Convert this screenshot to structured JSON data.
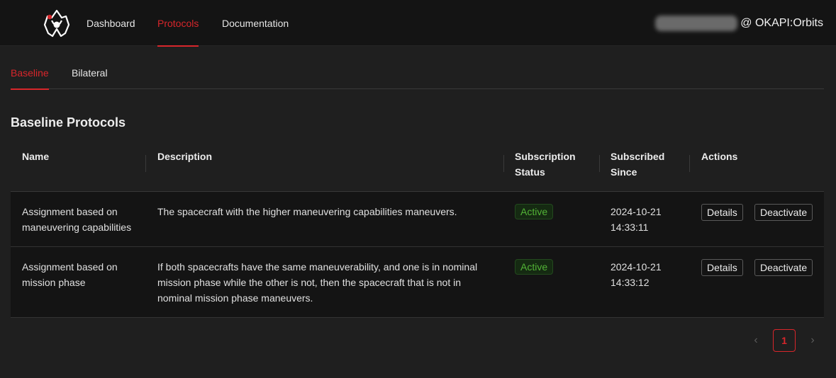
{
  "nav": {
    "items": [
      {
        "label": "Dashboard"
      },
      {
        "label": "Protocols",
        "active": true
      },
      {
        "label": "Documentation"
      }
    ],
    "user_suffix": "@ OKAPI:Orbits",
    "accent_color": "#d8262b"
  },
  "subtabs": [
    {
      "label": "Baseline",
      "active": true
    },
    {
      "label": "Bilateral"
    }
  ],
  "section_title": "Baseline Protocols",
  "table": {
    "columns": {
      "name": "Name",
      "description": "Description",
      "status_line1": "Subscription",
      "status_line2": "Status",
      "since_line1": "Subscribed",
      "since_line2": "Since",
      "actions": "Actions"
    },
    "rows": [
      {
        "name_line1": "Assignment based on",
        "name_line2": "maneuvering capabilities",
        "desc_line1": "The spacecraft with the higher maneuvering capabilities maneuvers.",
        "status": "Active",
        "date": "2024-10-21",
        "time": "14:33:11",
        "details": "Details",
        "deactivate": "Deactivate"
      },
      {
        "name_line1": "Assignment based on",
        "name_line2": "mission phase",
        "desc_line1": "If both spacecrafts have the same maneuverability, and one is in nominal",
        "desc_line2": "mission phase while the other is not, then the spacecraft that is not in",
        "desc_line3": "nominal mission phase maneuvers.",
        "status": "Active",
        "date": "2024-10-21",
        "time": "14:33:12",
        "details": "Details",
        "deactivate": "Deactivate"
      }
    ]
  },
  "pagination": {
    "current": "1",
    "prev_icon": "chevron-left-icon",
    "next_icon": "chevron-right-icon"
  }
}
